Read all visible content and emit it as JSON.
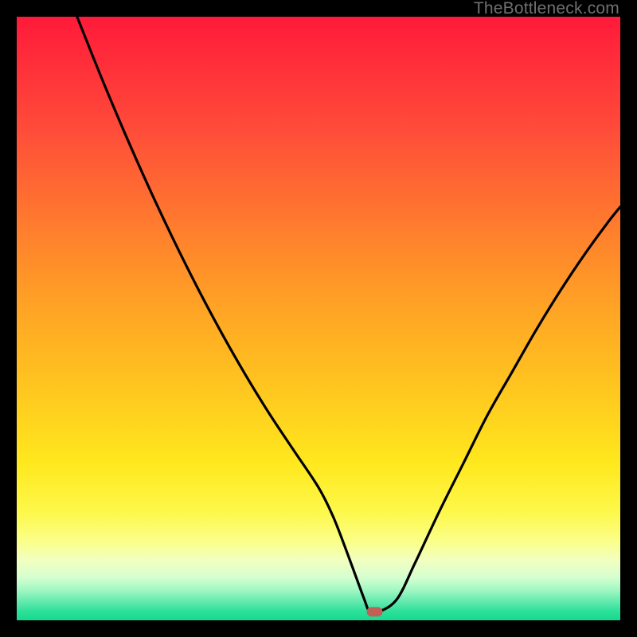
{
  "watermark": "TheBottleneck.com",
  "chart_data": {
    "type": "line",
    "title": "",
    "xlabel": "",
    "ylabel": "",
    "xlim": [
      0,
      100
    ],
    "ylim": [
      0,
      100
    ],
    "background": {
      "type": "vertical-gradient",
      "description": "red (top) through orange, yellow to green (bottom)",
      "stops": [
        {
          "pos": 0.0,
          "color": "#ff1a3a"
        },
        {
          "pos": 0.18,
          "color": "#ff4a3a"
        },
        {
          "pos": 0.48,
          "color": "#ffa325"
        },
        {
          "pos": 0.74,
          "color": "#ffe81e"
        },
        {
          "pos": 0.9,
          "color": "#f2ffc0"
        },
        {
          "pos": 1.0,
          "color": "#14db8f"
        }
      ]
    },
    "series": [
      {
        "name": "bottleneck-curve",
        "color": "#000000",
        "x": [
          10,
          14,
          18,
          22,
          26,
          30,
          34,
          38,
          42,
          46,
          50,
          52.5,
          55,
          57.5,
          58.5,
          60,
          63,
          66,
          70,
          74,
          78,
          82,
          86,
          90,
          94,
          98,
          100
        ],
        "y": [
          100,
          90,
          80.5,
          71.5,
          63,
          55,
          47.5,
          40.5,
          34,
          28,
          22,
          17,
          10.5,
          3.7,
          1.4,
          1.4,
          3.5,
          9.5,
          18,
          26,
          34,
          41,
          48,
          54.5,
          60.5,
          66,
          68.5
        ]
      }
    ],
    "markers": [
      {
        "name": "minimum-marker",
        "shape": "rounded-rect",
        "x": 59.3,
        "y": 1.4,
        "color": "#c06058"
      }
    ]
  }
}
